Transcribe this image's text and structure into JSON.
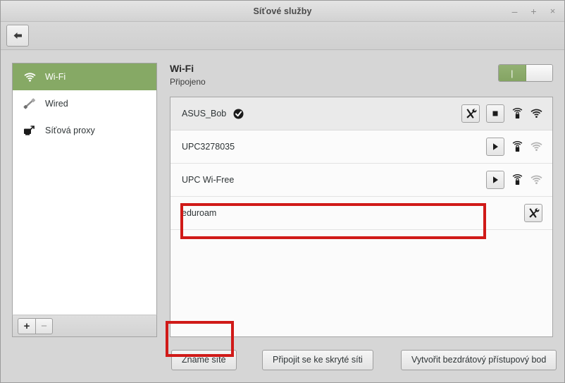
{
  "window": {
    "title": "Síťové služby",
    "controls": {
      "minimize": "–",
      "maximize": "+",
      "close": "×"
    },
    "back_button": "back-arrow"
  },
  "sidebar": {
    "items": [
      {
        "label": "Wi-Fi",
        "icon": "wifi-icon",
        "selected": true
      },
      {
        "label": "Wired",
        "icon": "ethernet-cable-icon",
        "selected": false
      },
      {
        "label": "Síťová proxy",
        "icon": "network-proxy-icon",
        "selected": false
      }
    ],
    "footer": {
      "add_label": "+",
      "remove_label": "−"
    }
  },
  "main": {
    "title": "Wi-Fi",
    "status": "Připojeno",
    "toggle": {
      "state": "on",
      "on_mark": "|"
    },
    "networks": [
      {
        "name": "ASUS_Bob",
        "connected": true,
        "active": true,
        "has_settings": true,
        "action": "stop",
        "secured": true,
        "signal": "strong"
      },
      {
        "name": "UPC3278035",
        "connected": false,
        "active": false,
        "has_settings": false,
        "action": "connect",
        "secured": true,
        "signal": "weak"
      },
      {
        "name": "UPC Wi-Free",
        "connected": false,
        "active": false,
        "has_settings": false,
        "action": "connect",
        "secured": true,
        "signal": "weak"
      },
      {
        "name": "eduroam",
        "connected": false,
        "active": false,
        "has_settings": true,
        "action": "none",
        "secured": false,
        "signal": "none"
      }
    ]
  },
  "footer": {
    "known_networks": "Známé sítě",
    "connect_hidden": "Připojit se ke skryté síti",
    "create_hotspot": "Vytvořit bezdrátový přístupový bod"
  },
  "colors": {
    "accent_green": "#86a965",
    "annotation_red": "#d01a18",
    "window_bg": "#d6d6d6",
    "list_bg": "#fbfbfb"
  }
}
